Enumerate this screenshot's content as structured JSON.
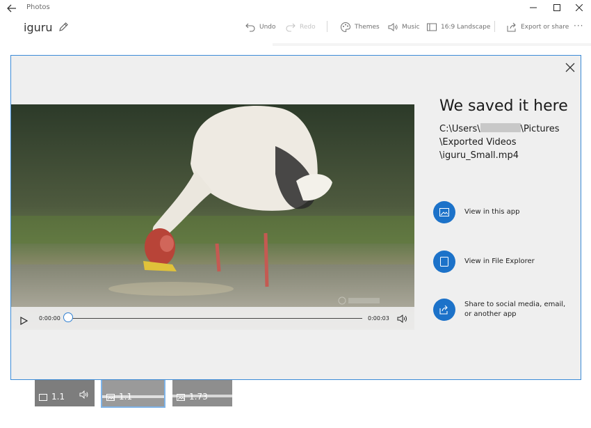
{
  "window": {
    "app_title": "Photos"
  },
  "toolbar": {
    "project_name": "iguru",
    "undo_label": "Undo",
    "redo_label": "Redo",
    "themes_label": "Themes",
    "music_label": "Music",
    "aspect_label": "16:9 Landscape",
    "export_label": "Export or share",
    "more_label": "···"
  },
  "storyboard": {
    "clips": [
      {
        "duration": "1.1",
        "selected": false
      },
      {
        "duration": "1.1",
        "selected": true
      },
      {
        "duration": "1.73",
        "selected": false
      }
    ]
  },
  "dialog": {
    "title": "We saved it here",
    "path": {
      "line1_prefix": "C:\\Users\\",
      "line1_suffix": "\\Pictures",
      "line2": "\\Exported Videos",
      "line3": "\\iguru_Small.mp4"
    },
    "player": {
      "current_time": "0:00:00",
      "end_time": "0:00:03",
      "progress": 0.0
    },
    "actions": [
      {
        "label": "View in this app",
        "icon": "image-icon"
      },
      {
        "label": "View in File Explorer",
        "icon": "tablet-icon"
      },
      {
        "label": "Share to social media, email,\nor another app",
        "icon": "share-icon"
      }
    ]
  },
  "colors": {
    "accent": "#1c72c9",
    "dialog_border": "#3a8ad7",
    "dialog_bg": "#efefef"
  }
}
